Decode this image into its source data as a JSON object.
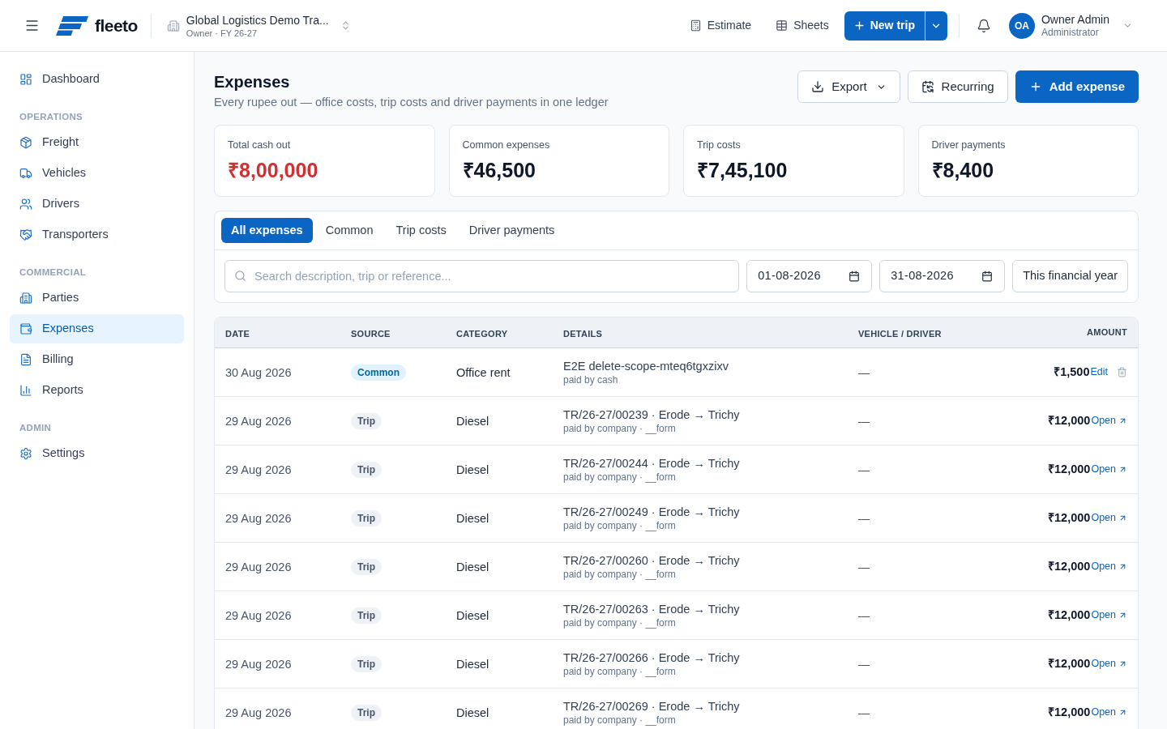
{
  "topbar": {
    "brand": "fleeto",
    "org": {
      "name": "Global Logistics Demo Tra...",
      "meta": "Owner · FY 26-27"
    },
    "actions": [
      {
        "label": "Estimate"
      },
      {
        "label": "Sheets"
      }
    ],
    "primary_action": {
      "label": "New trip"
    },
    "user": {
      "initials": "OA",
      "name": "Owner Admin",
      "role": "Administrator"
    }
  },
  "sidebar": {
    "sections": [
      {
        "items": [
          {
            "label": "Dashboard",
            "selected": false
          }
        ]
      },
      {
        "title": "OPERATIONS",
        "items": [
          {
            "label": "Freight",
            "selected": false
          },
          {
            "label": "Vehicles",
            "selected": false
          },
          {
            "label": "Drivers",
            "selected": false
          },
          {
            "label": "Transporters",
            "selected": false
          }
        ]
      },
      {
        "title": "COMMERCIAL",
        "items": [
          {
            "label": "Parties",
            "selected": false
          },
          {
            "label": "Expenses",
            "selected": true
          },
          {
            "label": "Billing",
            "selected": false
          },
          {
            "label": "Reports",
            "selected": false
          }
        ]
      },
      {
        "title": "ADMIN",
        "items": [
          {
            "label": "Settings",
            "selected": false
          }
        ]
      }
    ]
  },
  "page": {
    "title": "Expenses",
    "subtitle": "Every rupee out — office costs, trip costs and driver payments in one ledger",
    "actions": [
      {
        "label": "Export",
        "kind": "menu"
      },
      {
        "label": "Recurring",
        "kind": "secondary"
      },
      {
        "label": "Add expense",
        "kind": "primary"
      }
    ]
  },
  "stats": [
    {
      "label": "Total cash out",
      "value": "₹8,00,000",
      "color": "#d32f2f"
    },
    {
      "label": "Common expenses",
      "value": "₹46,500",
      "color": "#0f172a"
    },
    {
      "label": "Trip costs",
      "value": "₹7,45,100",
      "color": "#0f172a"
    },
    {
      "label": "Driver payments",
      "value": "₹8,400",
      "color": "#0f172a"
    }
  ],
  "tabs": [
    {
      "label": "All expenses",
      "selected": true
    },
    {
      "label": "Common",
      "selected": false
    },
    {
      "label": "Trip costs",
      "selected": false
    },
    {
      "label": "Driver payments",
      "selected": false
    }
  ],
  "filters": {
    "search": {
      "placeholder": "Search description, trip or reference..."
    },
    "date_from": {
      "value": "01-08-2026"
    },
    "date_to": {
      "value": "31-08-2026"
    },
    "preset": "This financial year"
  },
  "table": {
    "columns": [
      "DATE",
      "SOURCE",
      "CATEGORY",
      "DETAILS",
      "VEHICLE / DRIVER",
      "AMOUNT"
    ],
    "rows": [
      {
        "date": "30 Aug 2026",
        "source": {
          "label": "Common",
          "kind": "common"
        },
        "category": "Office rent",
        "details": {
          "title": "E2E delete-scope-mteq6tgxzixv",
          "note": "paid by cash"
        },
        "vehicle_driver": "—",
        "amount": "₹1,500",
        "action": {
          "label": "Edit",
          "kind": "edit"
        }
      },
      {
        "date": "29 Aug 2026",
        "source": {
          "label": "Trip",
          "kind": "trip"
        },
        "category": "Diesel",
        "details": {
          "title": "TR/26-27/00239 · Erode → Trichy",
          "note": "paid by company · __form"
        },
        "vehicle_driver": "—",
        "amount": "₹12,000",
        "action": {
          "label": "Open",
          "kind": "open"
        }
      },
      {
        "date": "29 Aug 2026",
        "source": {
          "label": "Trip",
          "kind": "trip"
        },
        "category": "Diesel",
        "details": {
          "title": "TR/26-27/00244 · Erode → Trichy",
          "note": "paid by company · __form"
        },
        "vehicle_driver": "—",
        "amount": "₹12,000",
        "action": {
          "label": "Open",
          "kind": "open"
        }
      },
      {
        "date": "29 Aug 2026",
        "source": {
          "label": "Trip",
          "kind": "trip"
        },
        "category": "Diesel",
        "details": {
          "title": "TR/26-27/00249 · Erode → Trichy",
          "note": "paid by company · __form"
        },
        "vehicle_driver": "—",
        "amount": "₹12,000",
        "action": {
          "label": "Open",
          "kind": "open"
        }
      },
      {
        "date": "29 Aug 2026",
        "source": {
          "label": "Trip",
          "kind": "trip"
        },
        "category": "Diesel",
        "details": {
          "title": "TR/26-27/00260 · Erode → Trichy",
          "note": "paid by company · __form"
        },
        "vehicle_driver": "—",
        "amount": "₹12,000",
        "action": {
          "label": "Open",
          "kind": "open"
        }
      },
      {
        "date": "29 Aug 2026",
        "source": {
          "label": "Trip",
          "kind": "trip"
        },
        "category": "Diesel",
        "details": {
          "title": "TR/26-27/00263 · Erode → Trichy",
          "note": "paid by company · __form"
        },
        "vehicle_driver": "—",
        "amount": "₹12,000",
        "action": {
          "label": "Open",
          "kind": "open"
        }
      },
      {
        "date": "29 Aug 2026",
        "source": {
          "label": "Trip",
          "kind": "trip"
        },
        "category": "Diesel",
        "details": {
          "title": "TR/26-27/00266 · Erode → Trichy",
          "note": "paid by company · __form"
        },
        "vehicle_driver": "—",
        "amount": "₹12,000",
        "action": {
          "label": "Open",
          "kind": "open"
        }
      },
      {
        "date": "29 Aug 2026",
        "source": {
          "label": "Trip",
          "kind": "trip"
        },
        "category": "Diesel",
        "details": {
          "title": "TR/26-27/00269 · Erode → Trichy",
          "note": "paid by company · __form"
        },
        "vehicle_driver": "—",
        "amount": "₹12,000",
        "action": {
          "label": "Open",
          "kind": "open"
        }
      }
    ]
  }
}
